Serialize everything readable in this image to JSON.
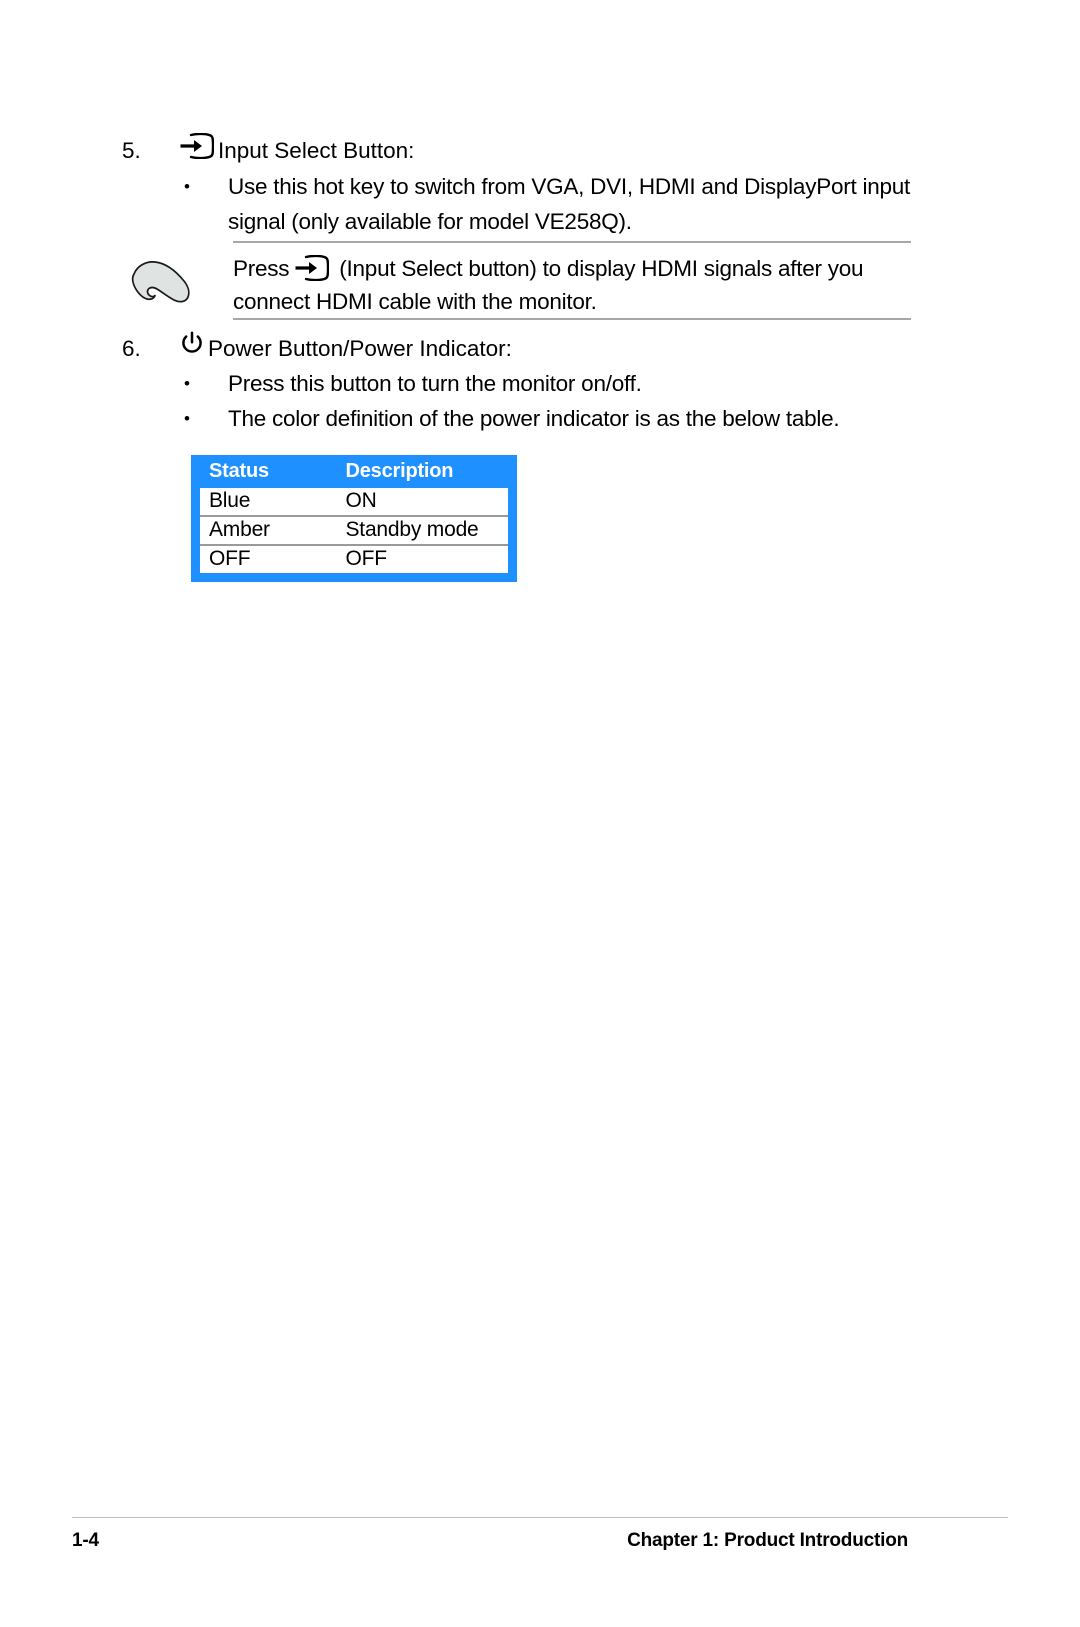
{
  "page": {
    "sections": [
      {
        "number": "5.",
        "icon": "input-select-icon",
        "heading": "Input Select Button:",
        "bullets": [
          {
            "marker": "•",
            "lines": [
              "Use this hot key to switch from VGA, DVI, HDMI and DisplayPort input",
              "signal (only available for model VE258Q)."
            ]
          }
        ]
      },
      {
        "number": "6.",
        "icon": "power-icon",
        "heading": "Power Button/Power Indicator:",
        "bullets": [
          {
            "marker": "•",
            "lines": [
              "Press this button to turn the monitor on/off."
            ]
          },
          {
            "marker": "•",
            "lines": [
              "The color definition of the power indicator is as the below table."
            ]
          }
        ]
      }
    ],
    "note": {
      "icon": "note-hand-icon",
      "line1_before_icon": "Press",
      "line1_icon": "input-select-icon",
      "line1_after_icon": "(Input Select button) to display HDMI signals after you",
      "line2": "connect HDMI cable with the monitor."
    },
    "table": {
      "headers": [
        "Status",
        "Description"
      ],
      "rows": [
        [
          "Blue",
          "ON"
        ],
        [
          "Amber",
          "Standby mode"
        ],
        [
          "OFF",
          "OFF"
        ]
      ],
      "accent_color": "#1e90ff",
      "header_text_color": "#ffffff"
    },
    "footer": {
      "page_number": "1-4",
      "chapter": "Chapter 1: Product Introduction"
    }
  }
}
